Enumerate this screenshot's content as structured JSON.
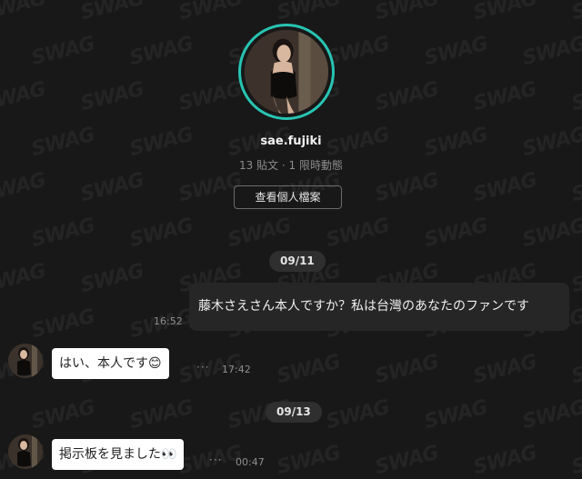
{
  "profile": {
    "username": "sae.fujiki",
    "stats": "13 貼文 · 1 限時動態",
    "view_profile_label": "查看個人檔案",
    "ring_color": "#27c4b3"
  },
  "watermark": {
    "text": "SWAG"
  },
  "messages": [
    {
      "type": "date",
      "label": "09/11"
    },
    {
      "type": "outgoing",
      "time": "16:52",
      "text": "藤木さえさん本人ですか？私は台灣のあなたのファンです"
    },
    {
      "type": "incoming",
      "time": "17:42",
      "text": "はい、本人です😊",
      "more": "···"
    },
    {
      "type": "date",
      "label": "09/13"
    },
    {
      "type": "incoming",
      "time": "00:47",
      "text": "掲示板を見ました👀",
      "more": "···"
    }
  ]
}
